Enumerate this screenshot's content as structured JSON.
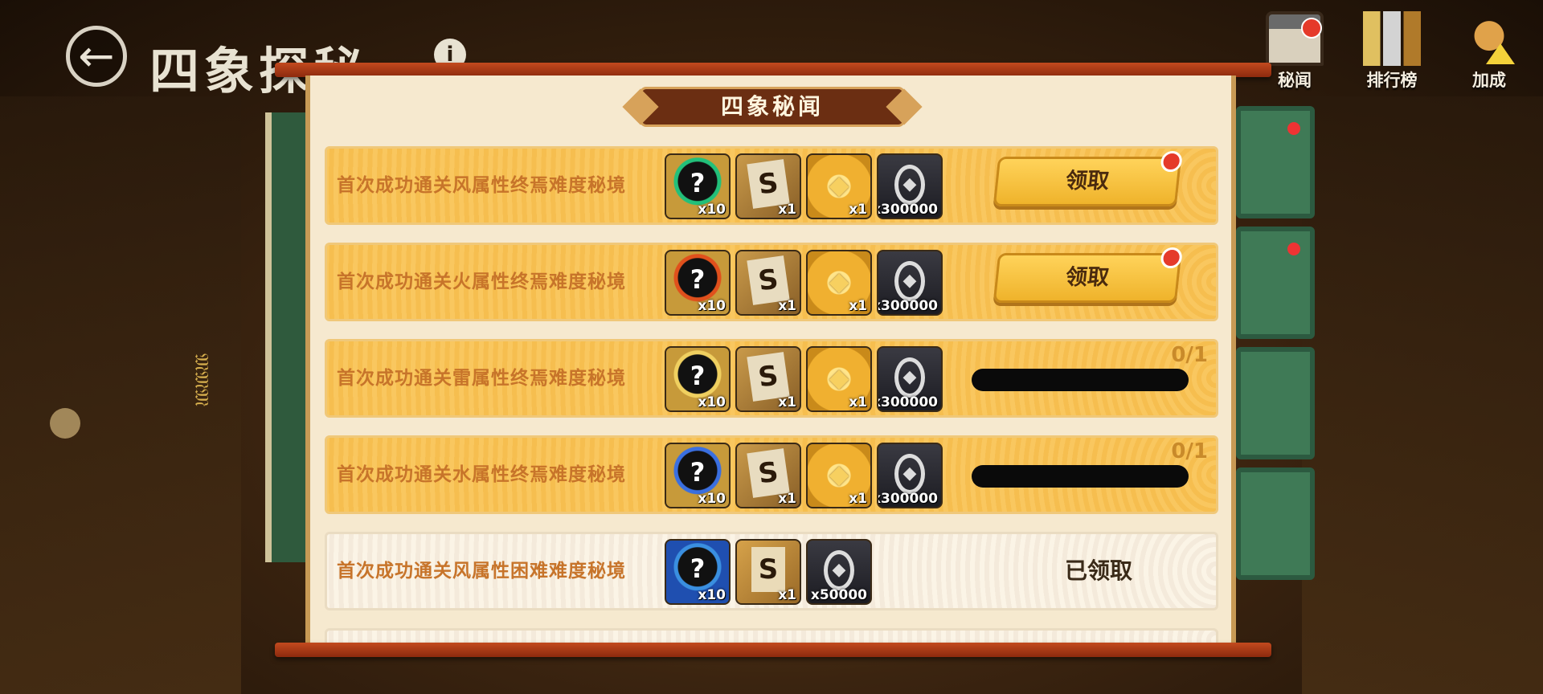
{
  "page": {
    "title": "四象探秘",
    "back_glyph": "←",
    "info_glyph": "i"
  },
  "top_buttons": [
    {
      "label": "秘闻",
      "icon": "notice-board-icon",
      "badge": true
    },
    {
      "label": "排行榜",
      "icon": "ranking-icon",
      "badge": false
    },
    {
      "label": "加成",
      "icon": "bonus-up-icon",
      "badge": false
    }
  ],
  "background": {
    "vertical_text": "𝔐𝔐𝔐"
  },
  "dialog": {
    "title": "四象秘闻"
  },
  "rows": [
    {
      "desc": "首次成功通关风属性终焉难度秘境",
      "rewards": [
        {
          "icon": "mystery-orb-green-icon",
          "glyph": "?",
          "qty": "x10"
        },
        {
          "icon": "scroll-icon",
          "glyph": "S",
          "qty": "x1"
        },
        {
          "icon": "gold-bundle-icon",
          "glyph": "◆",
          "qty": "x1"
        },
        {
          "icon": "coin-icon",
          "glyph": "◆",
          "qty": "x300000"
        }
      ],
      "status": "claim",
      "claim_label": "领取"
    },
    {
      "desc": "首次成功通关火属性终焉难度秘境",
      "rewards": [
        {
          "icon": "mystery-orb-red-icon",
          "glyph": "?",
          "qty": "x10"
        },
        {
          "icon": "scroll-icon",
          "glyph": "S",
          "qty": "x1"
        },
        {
          "icon": "gold-bundle-icon",
          "glyph": "◆",
          "qty": "x1"
        },
        {
          "icon": "coin-icon",
          "glyph": "◆",
          "qty": "x300000"
        }
      ],
      "status": "claim",
      "claim_label": "领取"
    },
    {
      "desc": "首次成功通关雷属性终焉难度秘境",
      "rewards": [
        {
          "icon": "mystery-orb-gold-icon",
          "glyph": "?",
          "qty": "x10"
        },
        {
          "icon": "scroll-icon",
          "glyph": "S",
          "qty": "x1"
        },
        {
          "icon": "gold-bundle-icon",
          "glyph": "◆",
          "qty": "x1"
        },
        {
          "icon": "coin-icon",
          "glyph": "◆",
          "qty": "x300000"
        }
      ],
      "status": "progress",
      "progress_text": "0/1",
      "progress": 0
    },
    {
      "desc": "首次成功通关水属性终焉难度秘境",
      "rewards": [
        {
          "icon": "mystery-orb-blue-icon",
          "glyph": "?",
          "qty": "x10"
        },
        {
          "icon": "scroll-icon",
          "glyph": "S",
          "qty": "x1"
        },
        {
          "icon": "gold-bundle-icon",
          "glyph": "◆",
          "qty": "x1"
        },
        {
          "icon": "coin-icon",
          "glyph": "◆",
          "qty": "x300000"
        }
      ],
      "status": "progress",
      "progress_text": "0/1",
      "progress": 0
    },
    {
      "desc": "首次成功通关风属性困难难度秘境",
      "rewards": [
        {
          "icon": "mystery-orb-blue-icon",
          "glyph": "?",
          "qty": "x10"
        },
        {
          "icon": "scroll-icon",
          "glyph": "S",
          "qty": "x1"
        },
        {
          "icon": "coin-icon",
          "glyph": "◆",
          "qty": "x50000"
        }
      ],
      "status": "claimed",
      "claimed_label": "已领取"
    }
  ]
}
